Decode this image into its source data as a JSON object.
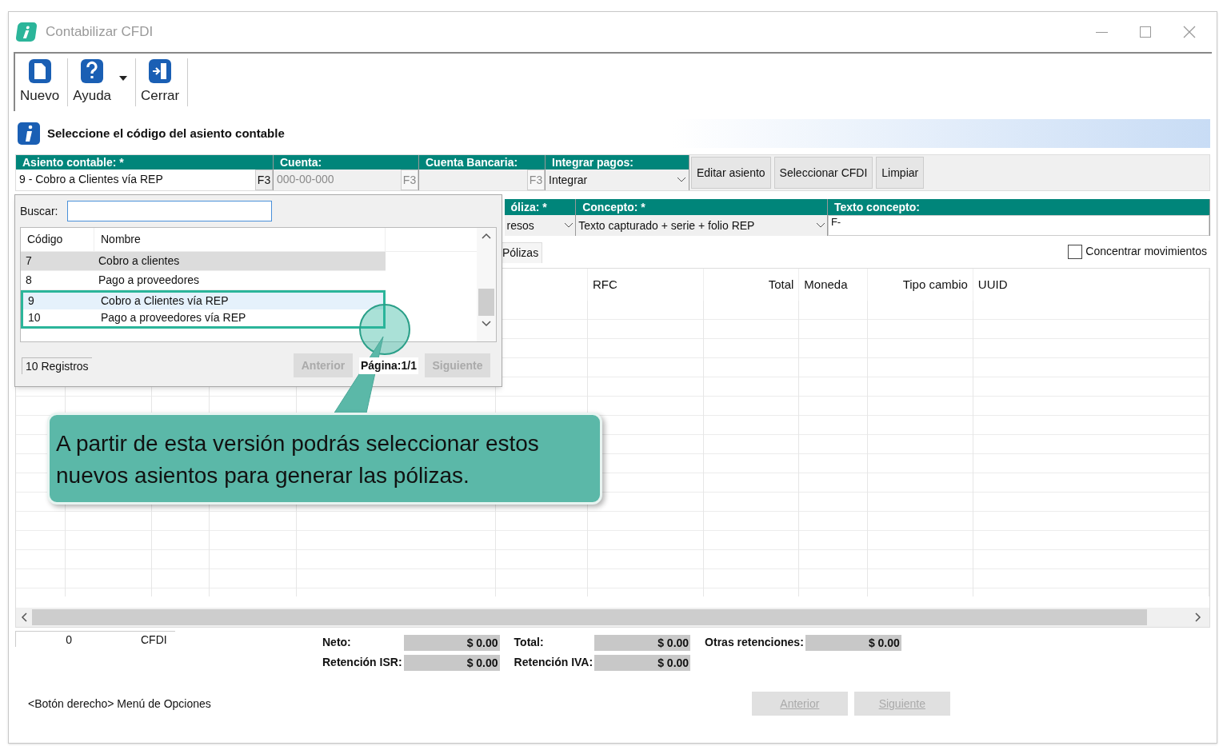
{
  "window": {
    "title": "Contabilizar CFDI"
  },
  "toolbar": [
    {
      "label": "Nuevo",
      "kind": "new",
      "dropdown": false
    },
    {
      "label": "Ayuda",
      "kind": "help",
      "dropdown": true
    },
    {
      "label": "Cerrar",
      "kind": "exit",
      "dropdown": false
    }
  ],
  "info_bar": {
    "message": "Seleccione el código del asiento contable"
  },
  "form_row_1": [
    {
      "kind": "lookup",
      "label": "Asiento contable: *",
      "value": "9 - Cobro a Clientes vía REP",
      "button": "F3",
      "disabled": false
    },
    {
      "kind": "lookup",
      "label": "Cuenta:",
      "placeholder": "000-00-000",
      "button": "F3",
      "disabled": true
    },
    {
      "kind": "lookup",
      "label": "Cuenta Bancaria:",
      "button": "F3",
      "disabled": true
    },
    {
      "kind": "select",
      "label": "Integrar pagos:",
      "value": "Integrar",
      "disabled": false
    }
  ],
  "actions": [
    "Editar asiento",
    "Seleccionar CFDI",
    "Limpiar"
  ],
  "form_row_2": [
    {
      "kind": "select",
      "label": "óliza: *",
      "value": "resos"
    },
    {
      "kind": "select",
      "label": "Concepto: *",
      "value": "Texto capturado + serie + folio REP"
    },
    {
      "kind": "text",
      "label": "Texto concepto:",
      "value": "F-"
    }
  ],
  "tabs": [
    {
      "label": "Pólizas",
      "selected": true
    }
  ],
  "concentrate": {
    "label": "Concentrar movimientos",
    "checked": false
  },
  "grid": {
    "columns": [
      "RFC",
      "Total",
      "Moneda",
      "Tipo cambio",
      "UUID"
    ]
  },
  "footer": {
    "count": "0",
    "count_label": "CFDI",
    "totals": [
      {
        "label": "Neto:",
        "value": "$ 0.00"
      },
      {
        "label": "Total:",
        "value": "$ 0.00"
      },
      {
        "label": "Otras retenciones:",
        "value": "$ 0.00"
      },
      {
        "label": "Retención ISR:",
        "value": "$ 0.00"
      },
      {
        "label": "Retención IVA:",
        "value": "$ 0.00"
      }
    ],
    "status": "<Botón derecho> Menú de Opciones",
    "buttons": [
      {
        "label": "Anterior",
        "disabled": true
      },
      {
        "label": "Siguiente",
        "disabled": true
      }
    ]
  },
  "popup": {
    "search_label": "Buscar:",
    "columns": [
      "Código",
      "Nombre"
    ],
    "rows": [
      {
        "code": "7",
        "name": "Cobro a clientes",
        "selected": true,
        "hovered": false,
        "highlighted": false
      },
      {
        "code": "8",
        "name": "Pago a proveedores",
        "selected": false,
        "hovered": false,
        "highlighted": false
      },
      {
        "code": "9",
        "name": "Cobro a Clientes vía REP",
        "selected": false,
        "hovered": true,
        "highlighted": true
      },
      {
        "code": "10",
        "name": "Pago a proveedores vía REP",
        "selected": false,
        "hovered": false,
        "highlighted": true
      }
    ],
    "count": "10 Registros",
    "page": "Página:1/1",
    "buttons": [
      {
        "label": "Anterior",
        "disabled": true
      },
      {
        "label": "Siguiente",
        "disabled": true
      }
    ]
  },
  "callout": {
    "text": "A partir de esta versión podrás seleccionar estos nuevos asientos para generar las pólizas."
  }
}
